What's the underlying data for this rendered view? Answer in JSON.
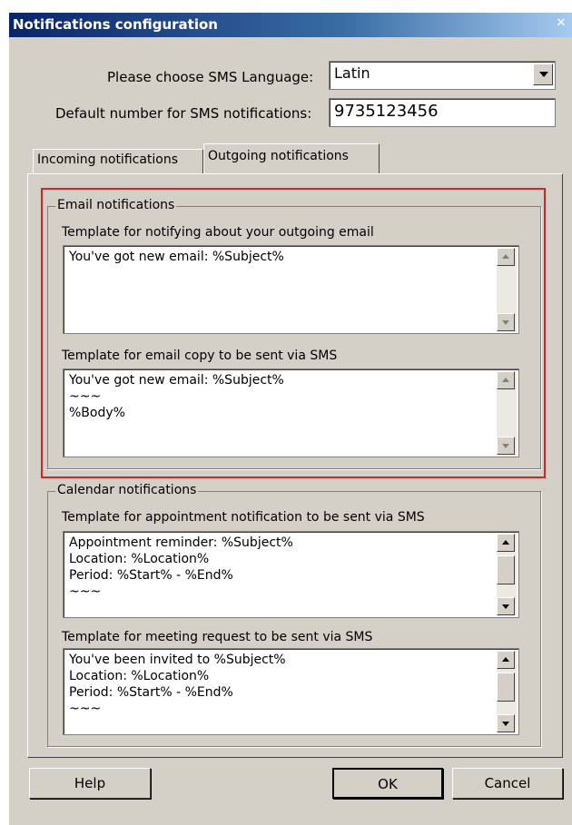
{
  "window": {
    "title": "Notifications configuration",
    "close_glyph": "✕"
  },
  "settings": {
    "sms_language_label": "Please choose SMS Language:",
    "sms_language_value": "Latin",
    "default_number_label": "Default number for SMS notifications:",
    "default_number_value": "9735123456"
  },
  "tabs": [
    {
      "label": "Incoming notifications",
      "active": false
    },
    {
      "label": "Outgoing notifications",
      "active": true
    }
  ],
  "email_group": {
    "title": "Email notifications",
    "outgoing_label": "Template for notifying about your outgoing email",
    "outgoing_text": "You've got new email: %Subject%",
    "copy_label": "Template for email copy to be sent via SMS",
    "copy_text": "You've got new email: %Subject%\n~~~\n%Body%"
  },
  "calendar_group": {
    "title": "Calendar notifications",
    "appointment_label": "Template for appointment notification to be sent via SMS",
    "appointment_text": "Appointment reminder: %Subject%\nLocation: %Location%\nPeriod: %Start% - %End%\n~~~",
    "meeting_label": "Template for meeting request to be sent via SMS",
    "meeting_text": "You've been invited to %Subject%\nLocation: %Location%\nPeriod: %Start% - %End%\n~~~"
  },
  "buttons": {
    "help": "Help",
    "ok": "OK",
    "cancel": "Cancel"
  },
  "colors": {
    "highlight": "#e02020",
    "dialog_bg": "#d4d0c8",
    "title_start": "#0a246a"
  }
}
